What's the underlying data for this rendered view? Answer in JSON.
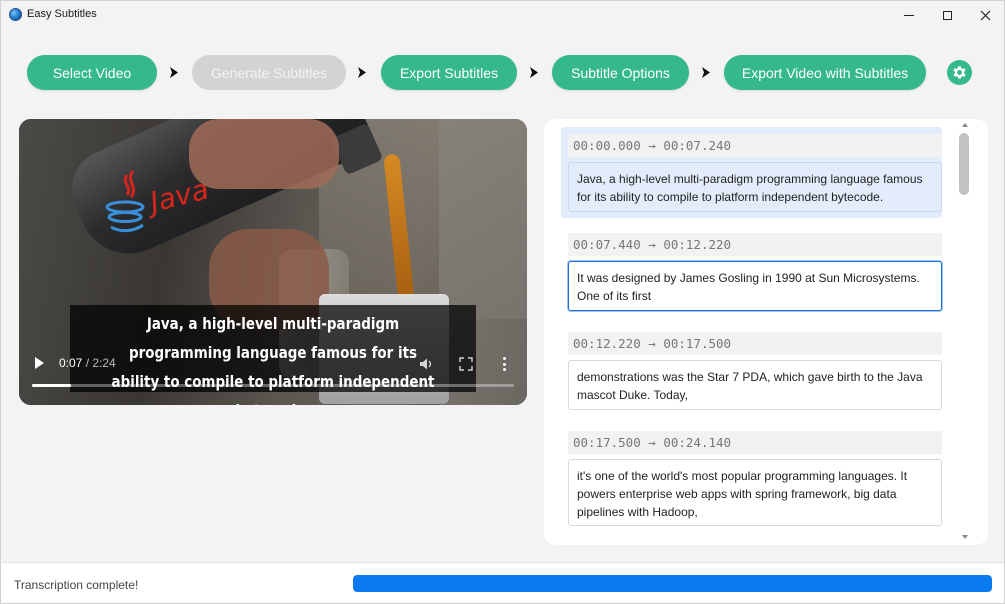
{
  "window": {
    "title": "Easy Subtitles",
    "controls": [
      "minimize",
      "maximize",
      "close"
    ]
  },
  "toolbar": {
    "steps": [
      {
        "label": "Select Video",
        "enabled": true
      },
      {
        "label": "Generate Subtitles",
        "enabled": false
      },
      {
        "label": "Export Subtitles",
        "enabled": true
      },
      {
        "label": "Subtitle Options",
        "enabled": true
      },
      {
        "label": "Export Video with Subtitles",
        "enabled": true
      }
    ],
    "separator_icon": "chevron-right-icon",
    "settings_icon": "gear-icon",
    "accent_color": "#35b98a",
    "disabled_color": "#d3d3d3"
  },
  "video": {
    "caption": "Java, a high-level multi-paradigm programming language famous for its ability to compile to platform independent bytecode.",
    "logo_text": "Java",
    "current_time": "0:07",
    "separator": " / ",
    "duration": "2:24",
    "progress_fraction": 0.08
  },
  "subtitles": [
    {
      "start": "00:00.000",
      "end": "00:07.240",
      "text": "Java, a high-level multi-paradigm programming language famous for its ability to compile to platform independent bytecode.",
      "state": "active"
    },
    {
      "start": "00:07.440",
      "end": "00:12.220",
      "text": "It was designed by James Gosling in 1990 at Sun Microsystems. One of its first",
      "state": "focused"
    },
    {
      "start": "00:12.220",
      "end": "00:17.500",
      "text": "demonstrations was the Star 7 PDA, which gave birth to the Java mascot Duke. Today,",
      "state": "normal"
    },
    {
      "start": "00:17.500",
      "end": "00:24.140",
      "text": "it's one of the world's most popular programming languages. It powers enterprise web apps with spring framework, big data pipelines with Hadoop,",
      "state": "normal"
    }
  ],
  "arrow": "→",
  "status": {
    "text": "Transcription complete!",
    "progress_fraction": 1.0,
    "progress_color": "#0a7bf0"
  }
}
